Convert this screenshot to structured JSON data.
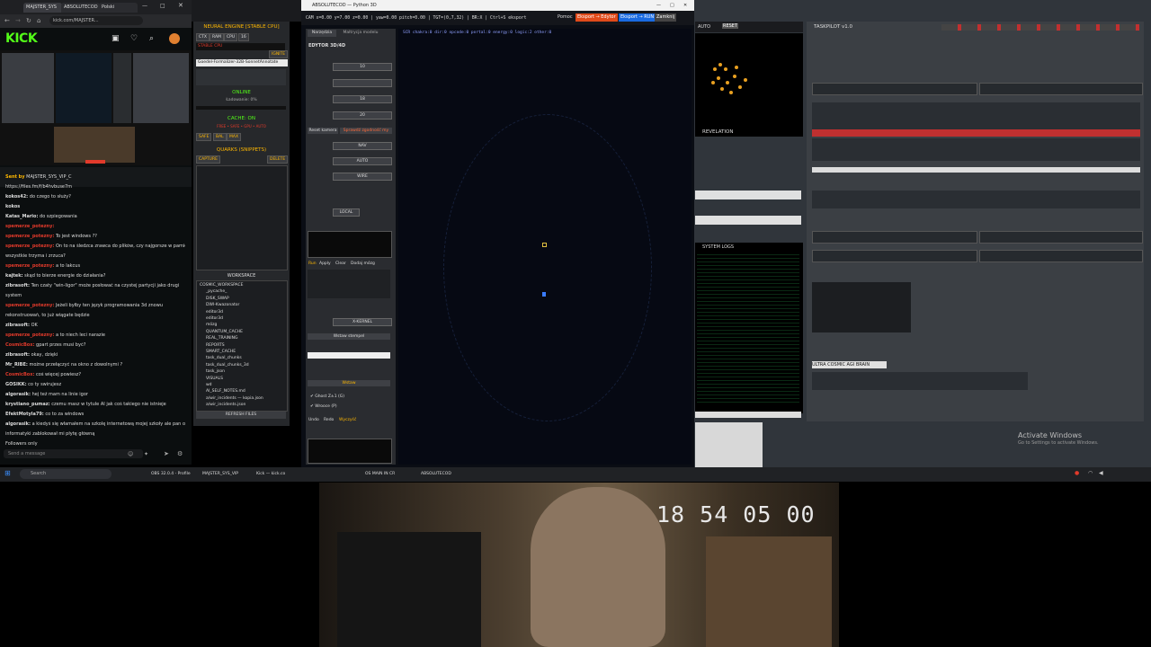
{
  "browser": {
    "tabs": [
      "MAJSTER_SYS",
      "ABSOLUTECOD",
      "Polski",
      "x"
    ],
    "url": "kick.com/MAJSTER...",
    "logo": "KICK",
    "chat_messages": [
      {
        "user": "Sent by",
        "text": "MAJSTER_SYS_VIP_C",
        "color": "#ffb800"
      },
      {
        "user": "",
        "text": "https://files.fm/f/b4hvbuse7m",
        "color": "#6aa9ff"
      },
      {
        "user": "kokos42:",
        "text": "do czego to służy?",
        "color": "#ddd"
      },
      {
        "user": "kokos",
        "text": "",
        "color": "#ddd"
      },
      {
        "user": "Katas_Mario:",
        "text": "do szpiegowania",
        "color": "#ddd"
      },
      {
        "user": "spemerze_potezny:",
        "text": "",
        "color": "#e23a2b"
      },
      {
        "user": "spemerze_potezny:",
        "text": "To jest windows ??",
        "color": "#e23a2b"
      },
      {
        "user": "spemerze_potezny:",
        "text": "On to na śledzca zrawca do plików, czy najgorsze w pamięci",
        "color": "#e23a2b"
      },
      {
        "user": "",
        "text": "wszystkie trzyma i zrzuca?",
        "color": "#ddd"
      },
      {
        "user": "spemerze_potezny:",
        "text": "a to lakcus",
        "color": "#e23a2b"
      },
      {
        "user": "kajtek:",
        "text": "skąd to bierze energie do działania?",
        "color": "#ddd"
      },
      {
        "user": "zibrasoft:",
        "text": "Ten czaty \"win-ligor\" może posłować na czystej partycji jako drugi",
        "color": "#ddd"
      },
      {
        "user": "",
        "text": "system",
        "color": "#ddd"
      },
      {
        "user": "spemerze_potezny:",
        "text": "Jeżeli byłby ten język programowania 3d znowu",
        "color": "#e23a2b"
      },
      {
        "user": "",
        "text": "rekonstruowań, to już wiągate będzie",
        "color": "#ddd"
      },
      {
        "user": "zibrasoft:",
        "text": "OK",
        "color": "#ddd"
      },
      {
        "user": "spemerze_potezny:",
        "text": "a to niech leci narazie",
        "color": "#e23a2b"
      },
      {
        "user": "CosmicBox:",
        "text": "gpart przes musi być?",
        "color": "#e23a2b"
      },
      {
        "user": "zibrasoft:",
        "text": "okay, dzięki",
        "color": "#ddd"
      },
      {
        "user": "Mr_RIBE:",
        "text": "możne przełączyć na okno z dowolnymi ?",
        "color": "#ddd"
      },
      {
        "user": "CosmicBox:",
        "text": "coś więcej powiesz?",
        "color": "#e23a2b"
      },
      {
        "user": "GOSIKK:",
        "text": "co ty swirujesz",
        "color": "#ddd"
      },
      {
        "user": "algorasik:",
        "text": "hej też mam na linie igor",
        "color": "#ddd"
      },
      {
        "user": "krystiano_pumaz:",
        "text": "czemu masz w tytule AI jak coś takiego nie istnieje",
        "color": "#ddd"
      },
      {
        "user": "EfektMotyla79:",
        "text": "co to za windows",
        "color": "#ddd"
      },
      {
        "user": "algorasik:",
        "text": "a kiedyś się włamałem na szkolę internetową mojej szkoły ale pan od",
        "color": "#ddd"
      },
      {
        "user": "",
        "text": "informatyki zablokował mi płytę główną",
        "color": "#ddd"
      },
      {
        "user": "",
        "text": "Followers only",
        "color": "#888"
      }
    ],
    "chat_placeholder": "Send a message"
  },
  "neural": {
    "title": "NEURAL ENGINE [STABLE CPU]",
    "model": "Goedel-Formalizer-32B-SonnetAnnotate",
    "online": "ONLINE",
    "loading": "Ładowanie: 0%",
    "cache": "CACHE: ON",
    "quarks": "QUARKS (SNIPPETS)",
    "capture": "CAPTURE",
    "delete": "DELETE",
    "workspace": "WORKSPACE",
    "tree": [
      "COSMIC_WORKSPACE",
      "_pycache_",
      "DISK_SWAP",
      "DWI-Kwazonator",
      "editor3d",
      "editor3d",
      "mózg",
      "QUANTUM_CACHE",
      "REAL_TRAINING",
      "REPORTS",
      "SMART_CACHE",
      "task_dual_chunks",
      "task_dual_chunks_3d",
      "task_json",
      "VISUALS",
      "wd",
      "AI_SELF_NOTES.md",
      "a/wir_incidents — kopia.json",
      "a/wir_incidents.json"
    ],
    "refresh": "REFRESH FILES"
  },
  "editor": {
    "title": "ABSOLUTECOD — Python 3D",
    "status": "CAM x=0.00 y=7.00 z=0.00 | yaw=0.00 pitch=0.00 | TGT=(0,7,32) | BR:X | Ctrl+S eksport",
    "menu": [
      "Pomoc",
      "Eksport → Edytor",
      "Eksport → RUN",
      "Zamknij"
    ],
    "tabs": [
      "Narzędzia",
      "Maltrycja modelu"
    ],
    "panel_title": "EDYTOR 3D/4D",
    "btn_reset": "Reset kamera",
    "btn_check": "Sprawdź zgodność my",
    "mode_labels": [
      "NAV",
      "AUTO",
      "WIRE"
    ],
    "local": "LOCAL",
    "btn_row": [
      "Run",
      "Apply",
      "Clear",
      "Dodaj mózg"
    ],
    "btn_stamp": "Wstaw stempel",
    "btn_insert": "Wstaw",
    "check1": "Ghost Z±1 (G)",
    "check2": "Wrooce (P)",
    "btn_undo": "Undo",
    "btn_redo": "Redo",
    "btn_clear": "Wyczyść",
    "sensors": "SCR chakra:0 dir:0 opcode:0 portal:0 energy:0 logic:2 other:0"
  },
  "right": {
    "revelation": "REVELATION",
    "auto": "AUTO",
    "reset": "RESET",
    "syslogs_title": "SYSTEM LOGS",
    "taskpilot_title": "TASKPILOT v1.0",
    "brain": "ULTRA COSMIC AGI BRAIN",
    "activate_title": "Activate Windows",
    "activate_sub": "Go to Settings to activate Windows."
  },
  "taskbar": {
    "search": "Search",
    "items": [
      "OBS 32.0.4 - Profile",
      "MAJSTER_SYS_VIP",
      "Kick — kick.co",
      "OS MAIN IN CR",
      "ABSOLUTECOD"
    ]
  },
  "webcam": {
    "timecode": "18 54 05 00"
  }
}
